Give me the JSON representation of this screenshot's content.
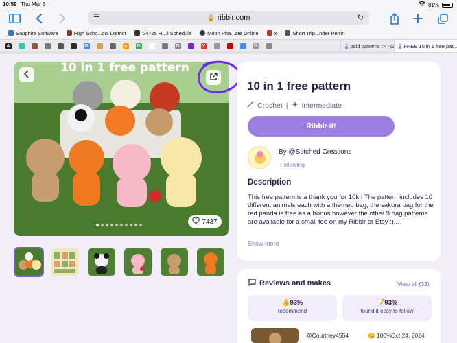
{
  "status_bar": {
    "time": "10:59",
    "date": "Thu Mar 6",
    "battery": "81%"
  },
  "browser": {
    "url": "ribblr.com",
    "bookmarks": [
      {
        "label": "Sapphire Software",
        "color": "#2e6fd6"
      },
      {
        "label": "High Scho...ool District",
        "color": "#8b3a2a"
      },
      {
        "label": "'24-'25 H...ll Schedule",
        "color": "#333333"
      },
      {
        "label": "Moon Pha...ate Online",
        "color": "#3a3a3a"
      },
      {
        "label": "x",
        "color": "#c0392b"
      },
      {
        "label": "Short Trip...nder Perrin",
        "color": "#555555"
      }
    ],
    "tabs_icons": [
      "A",
      "",
      "",
      "",
      "",
      "",
      "G",
      "",
      "",
      "a",
      "G",
      "",
      "",
      "G",
      "",
      "Y",
      "",
      "",
      "",
      "G",
      ""
    ],
    "tab_paid": "paid patterns :> - Ge...",
    "tab_active": "FREE 10 in 1 free pat..."
  },
  "gallery": {
    "image_title": "10 in 1 free pattern",
    "likes": "7437",
    "dots_count": 10
  },
  "product": {
    "title": "10 in 1 free pattern",
    "craft": "Crochet",
    "level": "Intermediate",
    "cta": "Ribblr it!",
    "by": "By @Stitched Creations",
    "following": "Following",
    "description_heading": "Description",
    "description": "This free pattern is a thank you for 10k!! The pattern includes 10 different animals each with a themed bag, the sakura bag for the red panda is free as a bonus however the other 9 bag patterns are available for a small fee on my Ribblr or Etsy :)...",
    "show_more": "Show more"
  },
  "reviews": {
    "heading": "Reviews and makes",
    "view_all": "View all (33)",
    "stats": [
      {
        "emoji": "👍",
        "pct": "93%",
        "label": "recommend"
      },
      {
        "emoji": "📝",
        "pct": "93%",
        "label": "found it easy to follow"
      }
    ],
    "first_review": {
      "user": "@Courtney4554",
      "pct": "😊 100%",
      "date": "Oct 24, 2024"
    }
  },
  "colors": {
    "accent": "#9b7ee0",
    "brand_link": "#7b5fd0",
    "ios_blue": "#1a73e8",
    "annotation": "#6b2ff0"
  },
  "icons": [
    "sidebar-icon",
    "back-icon",
    "forward-icon",
    "reader-icon",
    "lock-icon",
    "reload-icon",
    "share-icon",
    "plus-icon",
    "tabs-icon",
    "heart-icon",
    "chevron-left-icon",
    "external-link-icon",
    "yarn-icon",
    "sparkle-icon",
    "chat-icon",
    "chevron-right-icon"
  ]
}
